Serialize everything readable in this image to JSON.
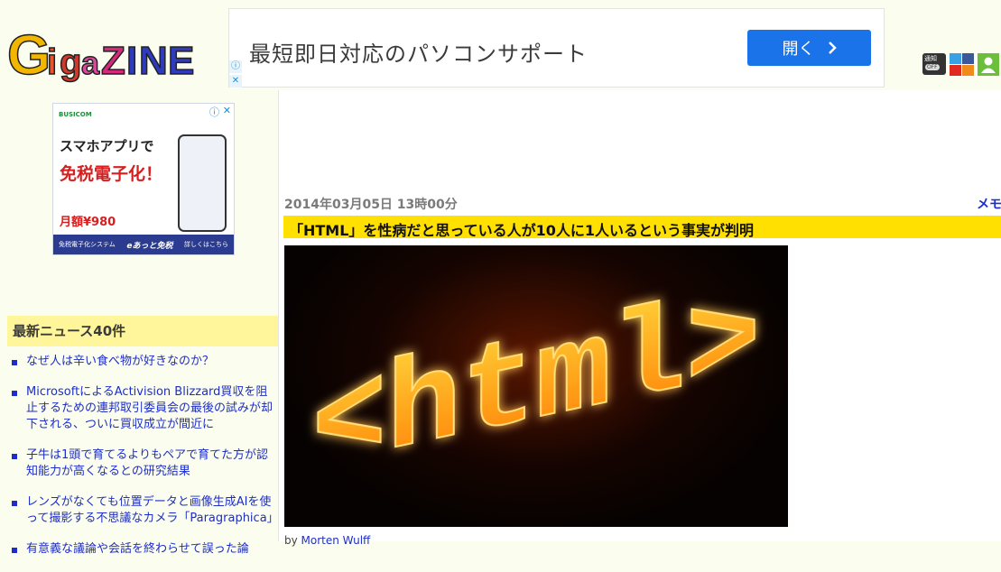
{
  "logo": {
    "letters": [
      "G",
      "i",
      "g",
      "a",
      "Z",
      "I",
      "N",
      "E"
    ]
  },
  "top_ad": {
    "text": "最短即日対応のパソコンサポート",
    "button_label": "開く",
    "choice_glyph": "ⓘ",
    "close_glyph": "✕"
  },
  "header_icons": {
    "notify_label": "通知",
    "notify_state": "OFF"
  },
  "side_ad": {
    "brand": "BUSICOM",
    "line1": "スマホアプリで",
    "line2": "免税電子化！",
    "price": "月額¥980",
    "footer_left": "免税電子化システム",
    "footer_brand": "eあっと免税",
    "footer_right": "詳しくはこちら"
  },
  "news": {
    "heading": "最新ニュース40件",
    "items": [
      "なぜ人は辛い食べ物が好きなのか？",
      "MicrosoftによるActivision Blizzard買収を阻止するための連邦取引委員会の最後の試みが却下される、ついに買収成立が間近に",
      "子牛は1頭で育てるよりもペアで育てた方が認知能力が高くなるとの研究結果",
      "レンズがなくても位置データと画像生成AIを使って撮影する不思議なカメラ「Paragraphica」",
      "有意義な議論や会話を終わらせて誤った論"
    ]
  },
  "article": {
    "date": "2014年03月05日 13時00分",
    "memo": "メモ",
    "title": "「HTML」を性病だと思っている人が10人に1人いるという事実が判明",
    "hero_text": "<html>",
    "byline_prefix": "by ",
    "byline_author": "Morten Wulff"
  },
  "colors": {
    "page_bg": "#fbfdef",
    "title_bar": "#ffe000",
    "news_heading_bg": "#fff59a",
    "link": "#1d2ec8",
    "ad_button": "#1a73e8"
  }
}
